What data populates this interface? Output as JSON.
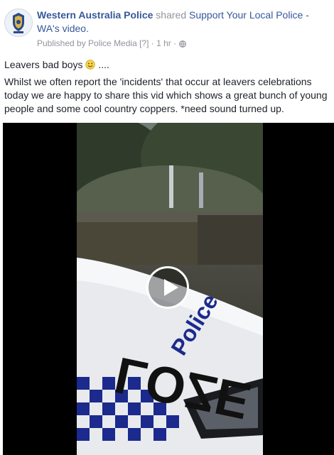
{
  "header": {
    "page_name": "Western Australia Police",
    "shared_word": " shared ",
    "shared_target": "Support Your Local Police - WA's video.",
    "published_by": "Published by Police Media",
    "help_marker": "[?]",
    "time": "1 hr",
    "separator": "·",
    "privacy_icon": "globe-icon",
    "avatar_icon": "police-crest-logo"
  },
  "post": {
    "title": "Leavers bad boys",
    "title_suffix": " ....",
    "emoji": "smiley-emoji",
    "body": "Whilst we often report the 'incidents' that occur at leavers celebrations today we are happy to share this vid which shows a great bunch of young people and some cool country coppers. *need sound turned up."
  },
  "video": {
    "play_icon": "play-icon",
    "car_text_number": "LOZE",
    "car_text_brand": "Police"
  },
  "colors": {
    "link": "#365899",
    "meta": "#90949c",
    "text": "#1d2129",
    "police_blue": "#1b2a8c"
  }
}
